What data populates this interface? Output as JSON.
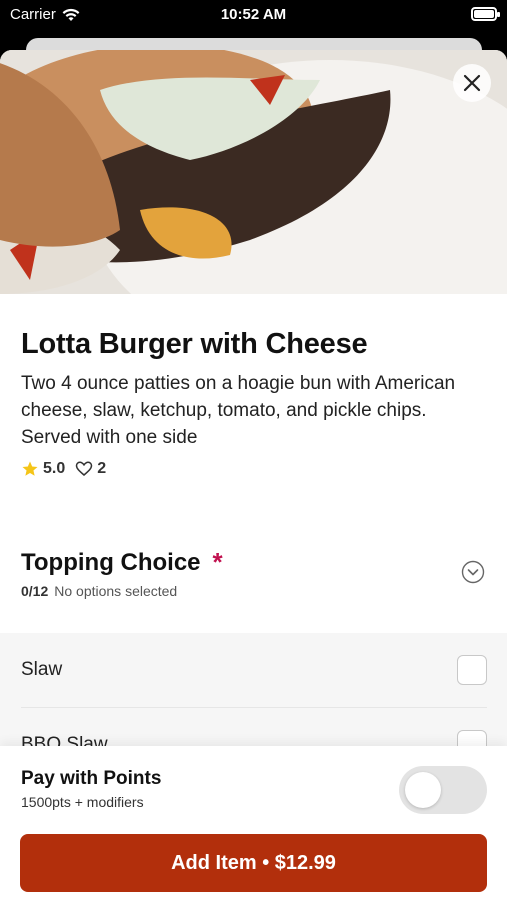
{
  "status_bar": {
    "carrier": "Carrier",
    "time": "10:52 AM"
  },
  "item": {
    "title": "Lotta Burger with Cheese",
    "description": "Two 4 ounce patties on a hoagie bun with American cheese, slaw, ketchup, tomato, and pickle chips. Served with one side",
    "rating": "5.0",
    "likes": "2",
    "image_icon": "burger-photo"
  },
  "section": {
    "title": "Topping Choice",
    "required_marker": "*",
    "count": "0/12",
    "status": "No options selected"
  },
  "options": [
    {
      "label": "Slaw",
      "checked": false
    },
    {
      "label": "BBQ Slaw",
      "checked": false
    }
  ],
  "footer": {
    "pay_title": "Pay with Points",
    "pay_sub": "1500pts + modifiers",
    "toggle_on": false,
    "add_button": "Add Item • $12.99"
  },
  "colors": {
    "accent": "#b22f0c",
    "required": "#c1114f",
    "star": "#f5c518"
  }
}
